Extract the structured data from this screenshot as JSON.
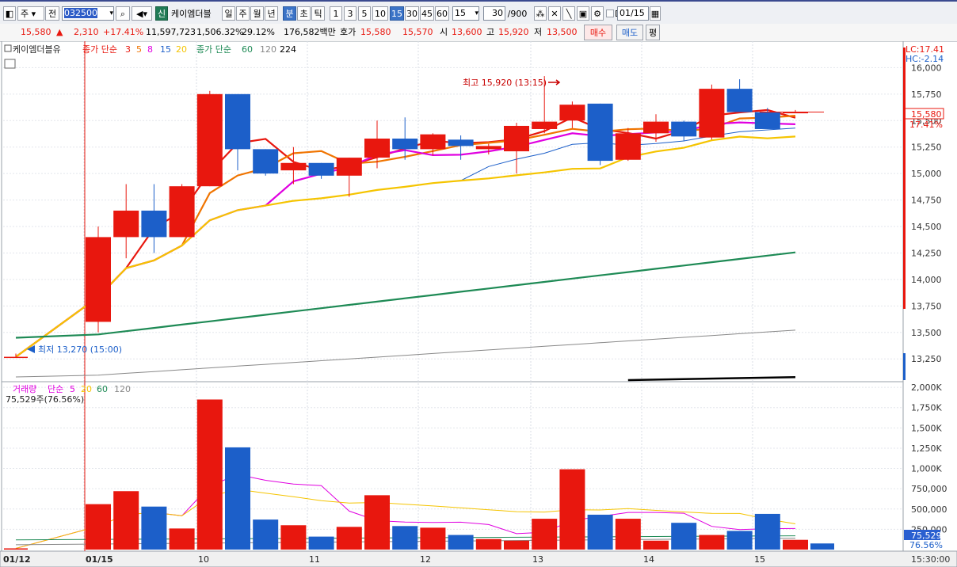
{
  "toolbar": {
    "market": "주",
    "prefix": "전",
    "code": "032500",
    "credit_badge": "신",
    "stock_name": "케이엠더블",
    "periods": [
      "일",
      "주",
      "월",
      "년"
    ],
    "intraday": [
      "분",
      "초",
      "틱"
    ],
    "minute_buttons": [
      "1",
      "3",
      "5",
      "10",
      "15",
      "30",
      "45",
      "60"
    ],
    "selected_minute": "15",
    "minute_select": "15",
    "count": "30",
    "count_total": "/900",
    "d_label": "D",
    "date": "01/15"
  },
  "quote": {
    "price": "15,580",
    "arrow": "▲",
    "change": "2,310",
    "change_pct": "+17.41%",
    "volume": "11,597,723",
    "volume_pct": "1,506.32%",
    "turnover_pct": "29.12%",
    "amount": "176,582백만",
    "ask_label": "호가",
    "ask": "15,580",
    "bid": "15,570",
    "open_label": "시",
    "open": "13,600",
    "high_label": "고",
    "high": "15,920",
    "low_label": "저",
    "low": "13,500",
    "buy": "매수",
    "sell": "매도",
    "eval": "평"
  },
  "price_pane": {
    "legend": {
      "name": "케이엠더블유",
      "ma_label": "종가 단순",
      "ma_periods": [
        "3",
        "5",
        "8",
        "15",
        "20"
      ],
      "ma_colors": [
        "#e8170e",
        "#f07400",
        "#e000e0",
        "#1c5fc9",
        "#f5c400"
      ],
      "ma2_label": "종가 단순",
      "ma2_periods": [
        "60",
        "120",
        "224"
      ],
      "ma2_colors": [
        "#1e8a55",
        "#888888",
        "#000000"
      ]
    },
    "lc": "LC:17.41",
    "hc": "HC:-2.14",
    "high_annotation": "최고 15,920 (13:15)",
    "low_annotation": "최저 13,270 (15:00)",
    "current_price_tag": "15,580",
    "current_pct_tag": "17.41%",
    "y_ticks": [
      "16,000",
      "15,750",
      "15,500",
      "15,250",
      "15,000",
      "14,750",
      "14,500",
      "14,250",
      "14,000",
      "13,750",
      "13,500",
      "13,250"
    ]
  },
  "volume_pane": {
    "legend": {
      "name": "거래량",
      "ma_label": "단순",
      "periods": [
        "5",
        "20",
        "60",
        "120"
      ],
      "colors": [
        "#e000e0",
        "#f5c400",
        "#1e8a55",
        "#888888"
      ]
    },
    "current": "75,529주(76.56%)",
    "tag_value": "75,529",
    "tag_pct": "76.56%",
    "y_ticks": [
      "2,000K",
      "1,750K",
      "1,500K",
      "1,250K",
      "1,000K",
      "750,000",
      "500,000",
      "250,000"
    ]
  },
  "x_axis": {
    "labels": [
      "01/12",
      "01/15",
      "10",
      "11",
      "12",
      "13",
      "14",
      "15"
    ],
    "time": "15:30:00"
  },
  "chart_data": {
    "type": "candlestick",
    "candles": [
      {
        "o": 13270,
        "h": 13300,
        "l": 13270,
        "c": 13270
      },
      {
        "o": 13600,
        "h": 14500,
        "l": 13500,
        "c": 14400
      },
      {
        "o": 14400,
        "h": 14900,
        "l": 14200,
        "c": 14650
      },
      {
        "o": 14650,
        "h": 14900,
        "l": 14250,
        "c": 14400
      },
      {
        "o": 14400,
        "h": 14900,
        "l": 14400,
        "c": 14880
      },
      {
        "o": 14880,
        "h": 15780,
        "l": 14880,
        "c": 15750
      },
      {
        "o": 15750,
        "h": 15750,
        "l": 15030,
        "c": 15230
      },
      {
        "o": 15230,
        "h": 15230,
        "l": 14980,
        "c": 15000
      },
      {
        "o": 15030,
        "h": 15250,
        "l": 14900,
        "c": 15100
      },
      {
        "o": 15100,
        "h": 15100,
        "l": 14950,
        "c": 14980
      },
      {
        "o": 14980,
        "h": 15150,
        "l": 14780,
        "c": 15150
      },
      {
        "o": 15150,
        "h": 15500,
        "l": 15050,
        "c": 15330
      },
      {
        "o": 15330,
        "h": 15530,
        "l": 15130,
        "c": 15230
      },
      {
        "o": 15230,
        "h": 15380,
        "l": 15170,
        "c": 15370
      },
      {
        "o": 15320,
        "h": 15360,
        "l": 15130,
        "c": 15260
      },
      {
        "o": 15230,
        "h": 15280,
        "l": 15180,
        "c": 15260
      },
      {
        "o": 15210,
        "h": 15480,
        "l": 15000,
        "c": 15450
      },
      {
        "o": 15420,
        "h": 15920,
        "l": 15380,
        "c": 15490
      },
      {
        "o": 15500,
        "h": 15680,
        "l": 15430,
        "c": 15650
      },
      {
        "o": 15660,
        "h": 15660,
        "l": 15080,
        "c": 15120
      },
      {
        "o": 15130,
        "h": 15430,
        "l": 15120,
        "c": 15380
      },
      {
        "o": 15380,
        "h": 15560,
        "l": 15300,
        "c": 15490
      },
      {
        "o": 15490,
        "h": 15500,
        "l": 15310,
        "c": 15350
      },
      {
        "o": 15340,
        "h": 15840,
        "l": 15320,
        "c": 15800
      },
      {
        "o": 15800,
        "h": 15890,
        "l": 15590,
        "c": 15580
      },
      {
        "o": 15580,
        "h": 15620,
        "l": 15420,
        "c": 15420
      },
      {
        "o": 15580,
        "h": 15600,
        "l": 15580,
        "c": 15580
      }
    ],
    "volume": [
      15000,
      560000,
      720000,
      530000,
      260000,
      1850000,
      1260000,
      370000,
      300000,
      160000,
      280000,
      670000,
      290000,
      270000,
      180000,
      130000,
      110000,
      380000,
      990000,
      430000,
      380000,
      110000,
      330000,
      180000,
      230000,
      440000,
      120000,
      75529
    ],
    "ylim_price": [
      13050,
      16100
    ],
    "ylim_volume": [
      0,
      2050000
    ]
  }
}
